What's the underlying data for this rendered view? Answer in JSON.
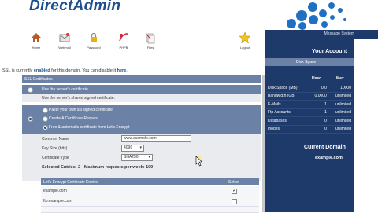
{
  "app": {
    "name": "DirectAdmin"
  },
  "nav": [
    {
      "label": "Home",
      "icon": "home-icon"
    },
    {
      "label": "Webmail",
      "icon": "webmail-icon"
    },
    {
      "label": "Password",
      "icon": "password-icon"
    },
    {
      "label": "PHPB",
      "icon": "phpmyadmin-icon"
    },
    {
      "label": "Files",
      "icon": "files-icon"
    },
    {
      "label": "Logout",
      "icon": "logout-icon"
    }
  ],
  "system": {
    "label": "Message System"
  },
  "ssl": {
    "status_prefix": "SSL is currently ",
    "status_value": "enabled",
    "status_suffix": " for this domain. You can disable it ",
    "status_link": "here",
    "section_title": "SSL Certificates",
    "option_server": "Use the server's certificate",
    "option_server_desc": "Use the server's shared signed certificate.",
    "option_own": "Paste your own ssl signed certificate",
    "option_request": "Create A Certificate Request",
    "option_letsencrypt": "Free & automatic certificate from Let's Encrypt",
    "common_name_label": "Common Name",
    "common_name_value": "www.example.com",
    "key_size_label": "Key Size (bits)",
    "key_size_value": "4096",
    "cert_type_label": "Certificate Type",
    "cert_type_value": "SHA256",
    "selected_entries": "Selected Entries: 2",
    "max_requests": "Maximum requests per week: 100"
  },
  "le_table": {
    "col_entries": "Let's Encrypt Certificate Entries",
    "col_select": "Select",
    "rows": [
      {
        "name": "example.com",
        "checked": true
      },
      {
        "name": "ftp.example.com",
        "checked": false
      }
    ]
  },
  "account": {
    "title": "Your Account",
    "disk_space_header": "Disk Space",
    "col_used": "Used",
    "col_max": "Max",
    "rows": [
      {
        "label": "Disk Space (MB)",
        "used": "0.0",
        "max": "10000"
      },
      {
        "label": "Bandwidth (GB)",
        "used": "0.0000",
        "max": "unlimited"
      },
      {
        "label": "E-Mails",
        "used": "1",
        "max": "unlimited"
      },
      {
        "label": "Ftp Accounts",
        "used": "1",
        "max": "unlimited"
      },
      {
        "label": "Databases",
        "used": "0",
        "max": "unlimited"
      },
      {
        "label": "Inodes",
        "used": "0",
        "max": "unlimited"
      }
    ],
    "current_domain_title": "Current Domain",
    "current_domain": "example.com"
  },
  "colors": {
    "brand": "#1d4f8c",
    "sidebar": "#1d3a6b",
    "bar": "#6c81a6",
    "bubble": "#1f6fc2"
  }
}
